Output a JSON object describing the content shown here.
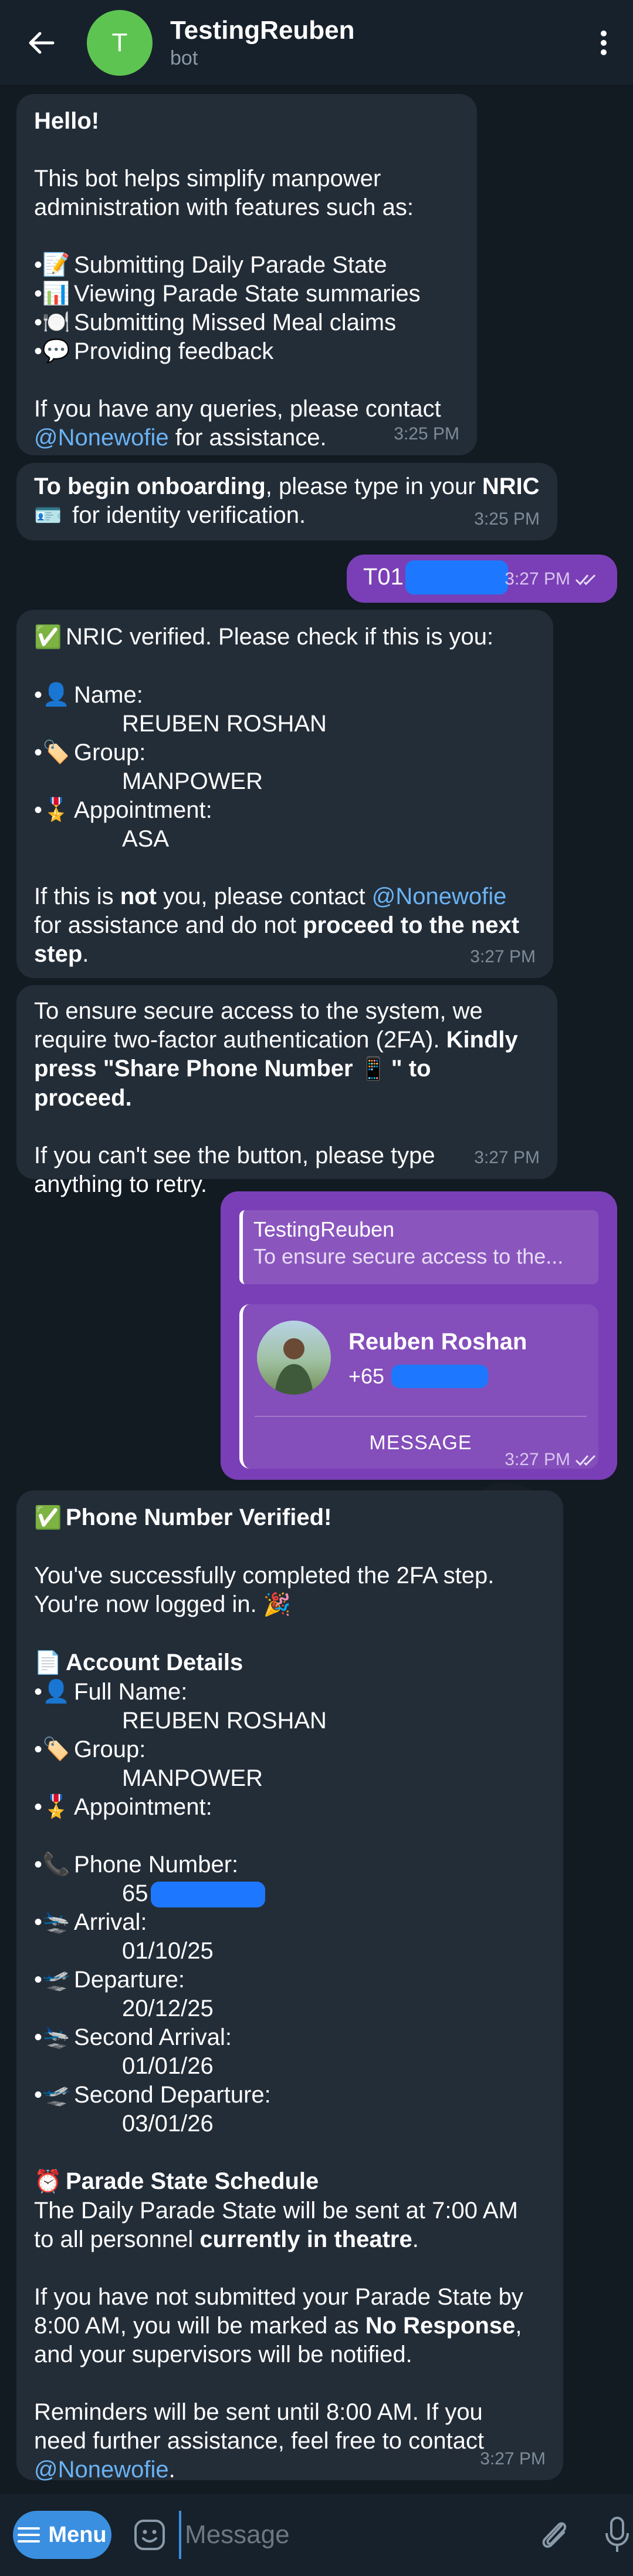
{
  "header": {
    "avatar_letter": "T",
    "title": "TestingReuben",
    "subtitle": "bot"
  },
  "messages": {
    "welcome": {
      "hello": "Hello!",
      "intro": "This bot helps simplify manpower administration with features such as:",
      "features": [
        {
          "icon": "memo-icon",
          "glyph": "📝",
          "text": "Submitting Daily Parade State"
        },
        {
          "icon": "bar-chart-icon",
          "glyph": "📊",
          "text": "Viewing Parade State summaries"
        },
        {
          "icon": "plate-icon",
          "glyph": "🍽️",
          "text": "Submitting Missed Meal claims"
        },
        {
          "icon": "speech-bubble-icon",
          "glyph": "💬",
          "text": "Providing feedback"
        }
      ],
      "contact_pre": "If you have any queries, please contact",
      "mention": "@Nonewofie",
      "contact_post": "for assistance.",
      "time": "3:25 PM"
    },
    "onboarding": {
      "bold1": "To begin onboarding",
      "text1": ", please type in your ",
      "bold2": "NRIC",
      "glyph": "🪪",
      "text2": "for identity verification.",
      "time": "3:25 PM"
    },
    "nric_sent": {
      "text": "T01",
      "time": "3:27 PM"
    },
    "nric_verified": {
      "glyph": "✅",
      "text": "NRIC verified. Please check if this is you:",
      "items": [
        {
          "glyph": "👤",
          "label": "Name:",
          "value": "REUBEN ROSHAN"
        },
        {
          "glyph": "🏷️",
          "label": "Group:",
          "value": "MANPOWER"
        },
        {
          "glyph": "🎖️",
          "label": "Appointment:",
          "value": "ASA"
        }
      ],
      "p1": "If this is ",
      "bold_not": "not",
      "p2": " you, please contact ",
      "mention": "@Nonewofie",
      "p3": "for assistance and do not ",
      "bold_proceed": "proceed to the next step",
      "p4": ".",
      "time": "3:27 PM"
    },
    "twofa": {
      "line1": "To ensure secure access to the system, we require two-factor authentication (2FA). ",
      "bold": "Kindly press \"Share Phone Number",
      "glyph": "📱",
      "bold_end": "\" to proceed.",
      "line2": "If you can't see the button, please type anything to retry.",
      "time": "3:27 PM"
    },
    "contact": {
      "reply_name": "TestingReuben",
      "reply_text": "To ensure secure access to the...",
      "name": "Reuben Roshan",
      "phone_prefix": "+65",
      "button": "MESSAGE",
      "time": "3:27 PM"
    },
    "verified": {
      "glyph": "✅",
      "title": "Phone Number Verified!",
      "p1": "You've successfully completed the 2FA step. You're now logged in.",
      "party": "🎉",
      "account_glyph": "📄",
      "account_title": "Account Details",
      "details": [
        {
          "glyph": "👤",
          "label": "Full Name:",
          "value": "REUBEN ROSHAN"
        },
        {
          "glyph": "🏷️",
          "label": "Group:",
          "value": "MANPOWER"
        },
        {
          "glyph": "🎖️",
          "label": "Appointment:",
          "value": ""
        },
        {
          "glyph": "📞",
          "label": "Phone Number:",
          "value": "65"
        },
        {
          "glyph": "🛬",
          "label": "Arrival:",
          "value": "01/10/25"
        },
        {
          "glyph": "🛫",
          "label": "Departure:",
          "value": "20/12/25"
        },
        {
          "glyph": "🛬",
          "label": "Second Arrival:",
          "value": "01/01/26"
        },
        {
          "glyph": "🛫",
          "label": "Second Departure:",
          "value": "03/01/26"
        }
      ],
      "schedule_glyph": "⏰",
      "schedule_title": "Parade State Schedule",
      "s1": "The Daily Parade State will be sent at 7:00 AM to all personnel ",
      "s1_bold": "currently in theatre",
      "s1_end": ".",
      "s2": "If you have not submitted your Parade State by 8:00 AM, you will be marked as ",
      "s2_bold": "No Response",
      "s2_end": ", and your supervisors will be notified.",
      "s3": "Reminders will be sent until 8:00 AM. If you need further assistance, feel free to contact",
      "mention": "@Nonewofie",
      "s3_end": ".",
      "time": "3:27 PM"
    }
  },
  "footer": {
    "menu_label": "Menu",
    "placeholder": "Message"
  },
  "colors": {
    "accent": "#3b8fe0",
    "outgoing_bubble": "#7a3fb6",
    "incoming_bubble": "#232d38",
    "mention": "#6ab3f3",
    "redaction": "#1d78ff"
  }
}
